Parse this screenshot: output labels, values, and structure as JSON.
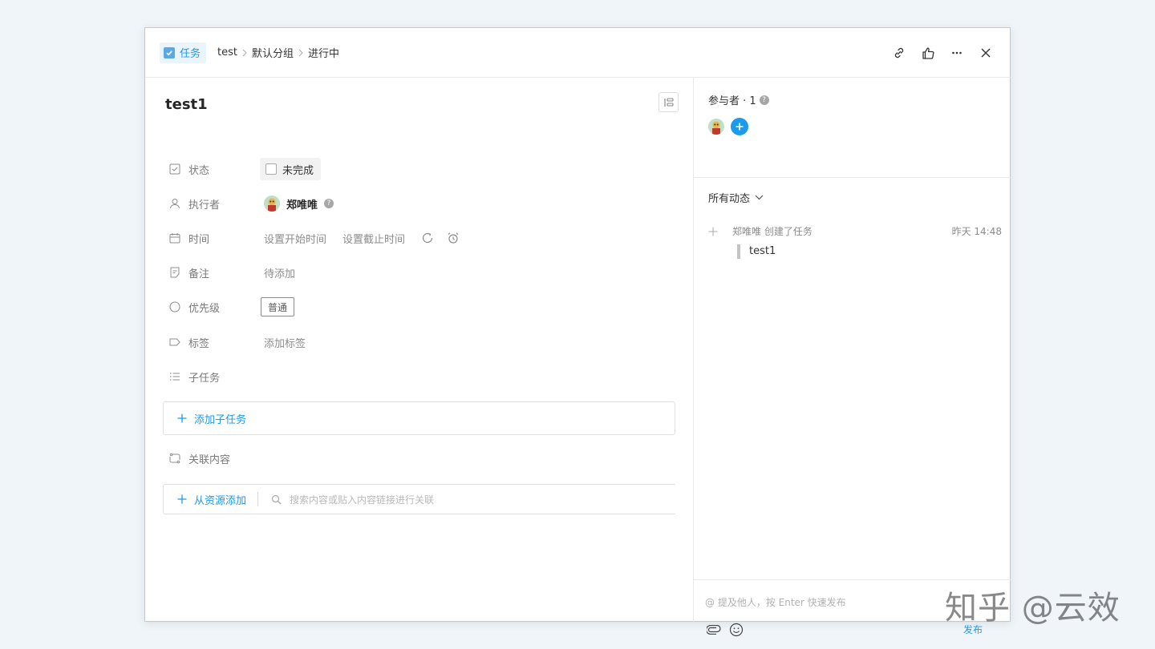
{
  "header": {
    "type_label": "任务",
    "breadcrumbs": [
      "test",
      "默认分组",
      "进行中"
    ],
    "actions": [
      "link-icon",
      "like-icon",
      "more-icon",
      "close-icon"
    ]
  },
  "task": {
    "title": "test1",
    "fields": {
      "status": {
        "label": "状态",
        "value": "未完成"
      },
      "assignee": {
        "label": "执行者",
        "value": "郑唯唯"
      },
      "time": {
        "label": "时间",
        "start": "设置开始时间",
        "end": "设置截止时间"
      },
      "note": {
        "label": "备注",
        "value": "待添加"
      },
      "priority": {
        "label": "优先级",
        "value": "普通"
      },
      "tags": {
        "label": "标签",
        "value": "添加标签"
      },
      "subtasks": {
        "label": "子任务",
        "add": "添加子任务"
      },
      "related": {
        "label": "关联内容",
        "add_from_resource": "从资源添加",
        "search_placeholder": "搜索内容或贴入内容链接进行关联"
      }
    }
  },
  "sidebar": {
    "participants_label": "参与者 · 1",
    "activity_filter": "所有动态",
    "activities": [
      {
        "text": "郑唯唯 创建了任务",
        "time": "昨天 14:48",
        "quote": "test1"
      }
    ],
    "comment_placeholder": "@ 提及他人，按 Enter 快速发布",
    "send_label": "发布"
  },
  "watermark": "知乎 @云效",
  "colors": {
    "accent": "#1b9aee",
    "badge_bg": "#eaf4fd",
    "page_bg": "#f0f5fa"
  }
}
